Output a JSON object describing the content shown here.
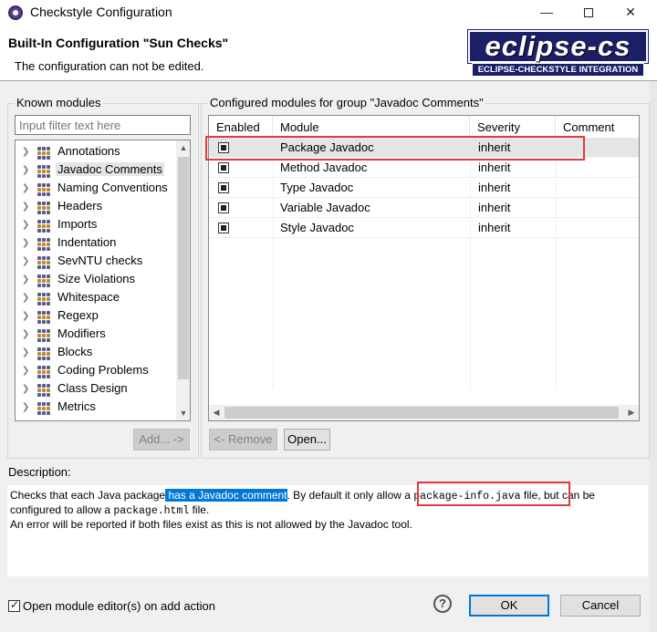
{
  "window": {
    "title": "Checkstyle Configuration",
    "min_glyph": "—",
    "close_glyph": "✕"
  },
  "header": {
    "title": "Built-In Configuration \"Sun Checks\"",
    "message": "The configuration can not be edited.",
    "logo_main": "eclipse-cs",
    "logo_sub": "ECLIPSE-CHECKSTYLE INTEGRATION"
  },
  "known_modules": {
    "label": "Known modules",
    "filter_placeholder": "Input filter text here",
    "items": [
      {
        "label": "Annotations",
        "selected": false
      },
      {
        "label": "Javadoc Comments",
        "selected": true
      },
      {
        "label": "Naming Conventions",
        "selected": false
      },
      {
        "label": "Headers",
        "selected": false
      },
      {
        "label": "Imports",
        "selected": false
      },
      {
        "label": "Indentation",
        "selected": false
      },
      {
        "label": "SevNTU checks",
        "selected": false
      },
      {
        "label": "Size Violations",
        "selected": false
      },
      {
        "label": "Whitespace",
        "selected": false
      },
      {
        "label": "Regexp",
        "selected": false
      },
      {
        "label": "Modifiers",
        "selected": false
      },
      {
        "label": "Blocks",
        "selected": false
      },
      {
        "label": "Coding Problems",
        "selected": false
      },
      {
        "label": "Class Design",
        "selected": false
      },
      {
        "label": "Metrics",
        "selected": false
      }
    ],
    "add_button": "Add... ->"
  },
  "configured_modules": {
    "label": "Configured modules for group \"Javadoc Comments\"",
    "columns": [
      "Enabled",
      "Module",
      "Severity",
      "Comment"
    ],
    "rows": [
      {
        "enabled": true,
        "module": "Package Javadoc",
        "severity": "inherit",
        "comment": "",
        "selected": true
      },
      {
        "enabled": true,
        "module": "Method Javadoc",
        "severity": "inherit",
        "comment": "",
        "selected": false
      },
      {
        "enabled": true,
        "module": "Type Javadoc",
        "severity": "inherit",
        "comment": "",
        "selected": false
      },
      {
        "enabled": true,
        "module": "Variable Javadoc",
        "severity": "inherit",
        "comment": "",
        "selected": false
      },
      {
        "enabled": true,
        "module": "Style Javadoc",
        "severity": "inherit",
        "comment": "",
        "selected": false
      }
    ],
    "remove_button": "<- Remove",
    "open_button": "Open..."
  },
  "description": {
    "label": "Description:",
    "p1_a": "Checks that each Java package",
    "p1_hl": " has a Javadoc comment",
    "p1_b": ". By default it only allow",
    "p1_c": " a ",
    "p1_code1": "package-info.java",
    "p1_d": " file, ",
    "p1_e": "but can be",
    "p2_a": "configured to allow a ",
    "p2_code": "package.html",
    "p2_b": " file.",
    "p3": "An error will be reported if both files exist as this is not allowed by the Javadoc tool."
  },
  "footer": {
    "open_editor_label": "Open module editor(s) on add action",
    "open_editor_checked": true,
    "help": "?",
    "ok_button": "OK",
    "cancel_button": "Cancel"
  },
  "colors": {
    "selection_highlight": "#0078d7",
    "annotation_red": "#e23a3a",
    "logo_navy": "#1a1f66"
  }
}
